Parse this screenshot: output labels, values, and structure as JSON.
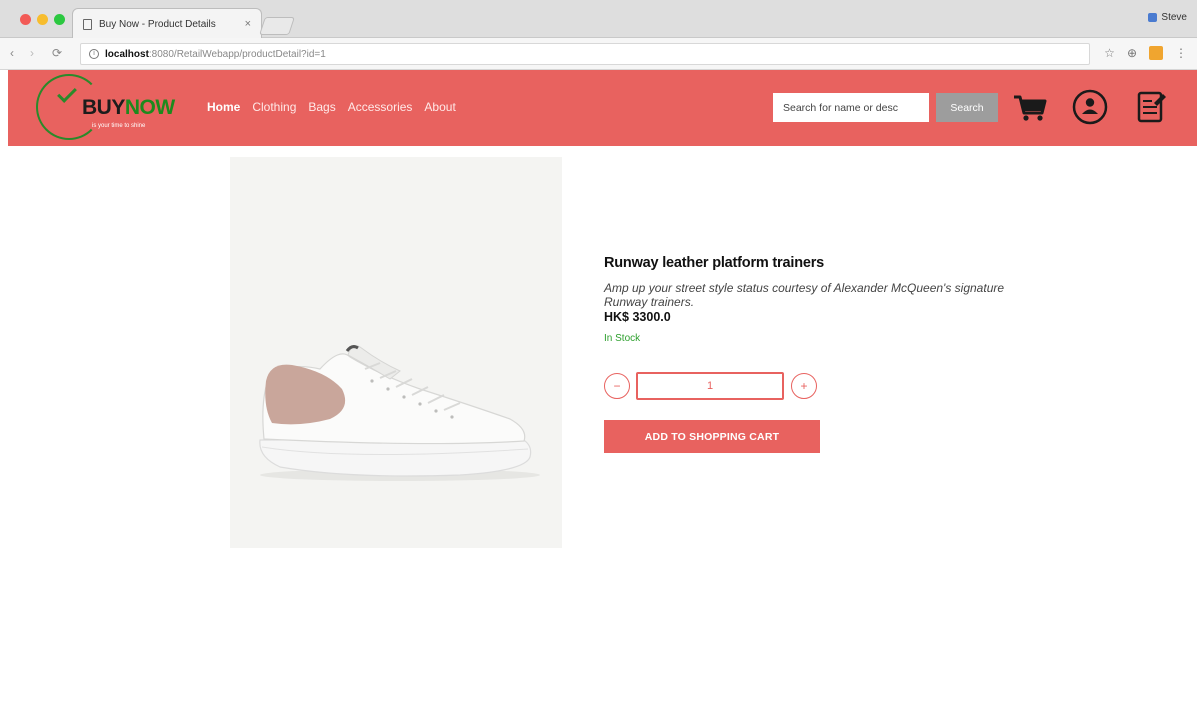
{
  "browser": {
    "tab_title": "Buy Now - Product Details",
    "tab_close": "×",
    "profile_name": "Steve",
    "url_host": "localhost",
    "url_path": ":8080/RetailWebapp/productDetail?id=1",
    "back": "‹",
    "forward": "›",
    "reload": "⟳"
  },
  "site": {
    "logo_buy": "BUY",
    "logo_now": "NOW",
    "logo_tagline": "is your time to shine",
    "nav": [
      {
        "label": "Home",
        "active": true
      },
      {
        "label": "Clothing"
      },
      {
        "label": "Bags"
      },
      {
        "label": "Accessories"
      },
      {
        "label": "About"
      }
    ],
    "search_placeholder": "Search for name or desc",
    "search_button": "Search",
    "icons": {
      "cart": "shopping-cart-icon",
      "account": "account-icon",
      "orders": "order-history-icon"
    },
    "brand_color": "#e8625f",
    "accent_green": "#1d8a1d"
  },
  "product": {
    "title": "Runway leather platform trainers",
    "description": "Amp up your street style status courtesy of Alexander McQueen's signature Runway trainers.",
    "price": "HK$ 3300.0",
    "stock": "In Stock",
    "quantity": "1",
    "qty_minus": "−",
    "qty_plus": "+",
    "add_to_cart": "ADD TO SHOPPING CART"
  }
}
